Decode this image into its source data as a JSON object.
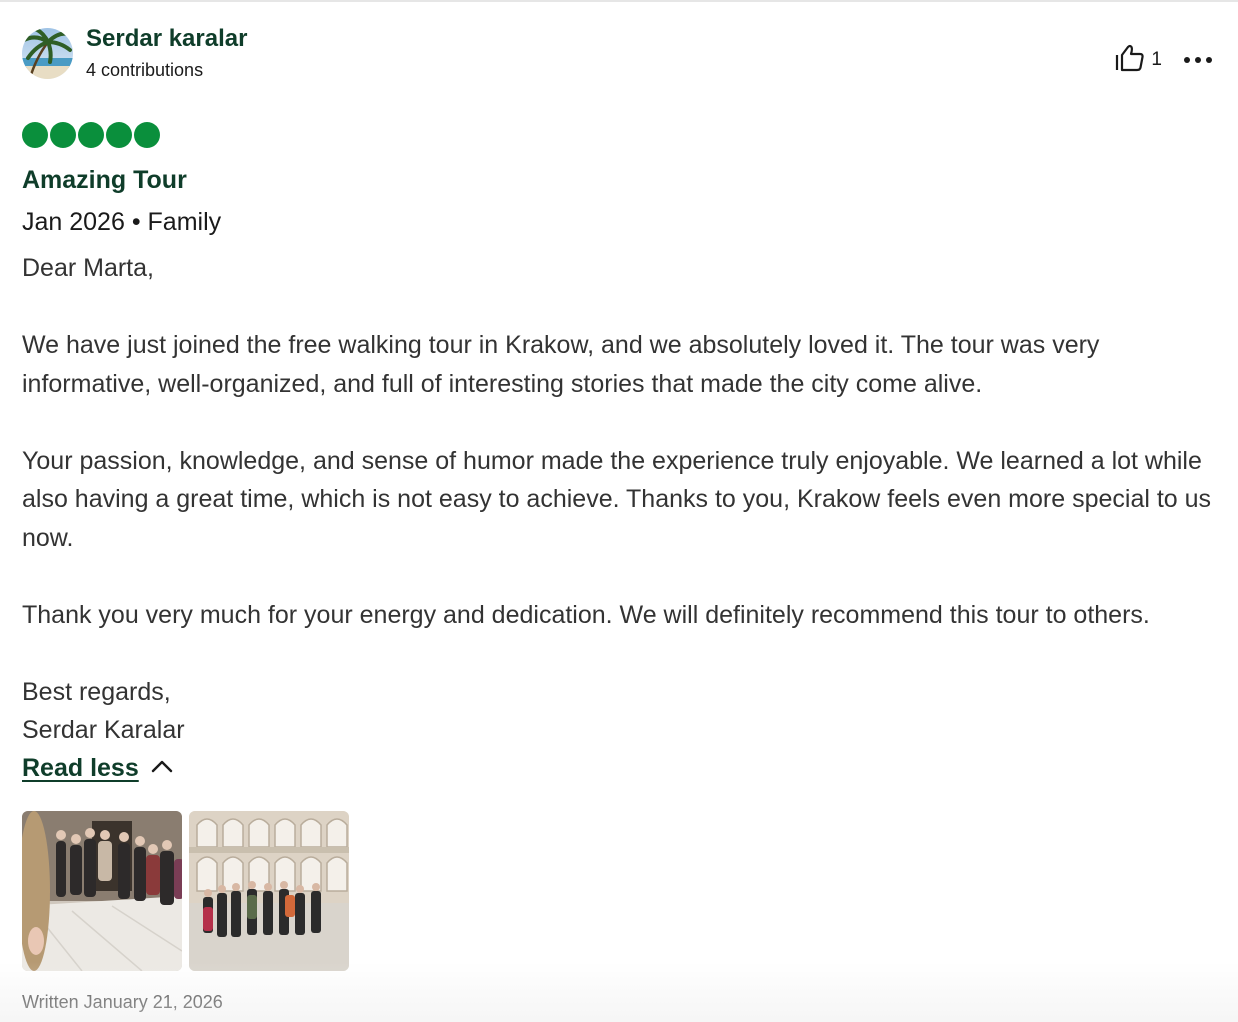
{
  "review": {
    "author": {
      "name": "Serdar karalar",
      "contributions": "4 contributions",
      "avatar_icon": "beach-palm-avatar"
    },
    "helpful": {
      "icon": "thumbs-up-icon",
      "count": "1"
    },
    "more_icon": "ellipsis-icon",
    "rating": {
      "value": 5,
      "max": 5,
      "color": "#0a8f3c"
    },
    "title": "Amazing Tour",
    "meta": "Jan 2026 • Family",
    "body": "Dear Marta,\n\nWe have just joined the free walking tour in Krakow, and we absolutely loved it. The tour was very informative, well-organized, and full of interesting stories that made the city come alive.\n\nYour passion, knowledge, and sense of humor made the experience truly enjoyable. We learned a lot while also having a great time, which is not easy to achieve. Thanks to you, Krakow feels even more special to us now.\n\nThank you very much for your energy and dedication. We will definitely recommend this tour to others.\n\nBest regards,\nSerdar Karalar",
    "read_less_label": "Read less",
    "read_less_icon": "chevron-up-icon",
    "photos": [
      "group-photo-indoor",
      "group-photo-courtyard"
    ],
    "written": "Written January 21, 2026"
  },
  "colors": {
    "brand_dark_green": "#0f3d2a",
    "bubble_green": "#0a8f3c",
    "text": "#333333"
  }
}
